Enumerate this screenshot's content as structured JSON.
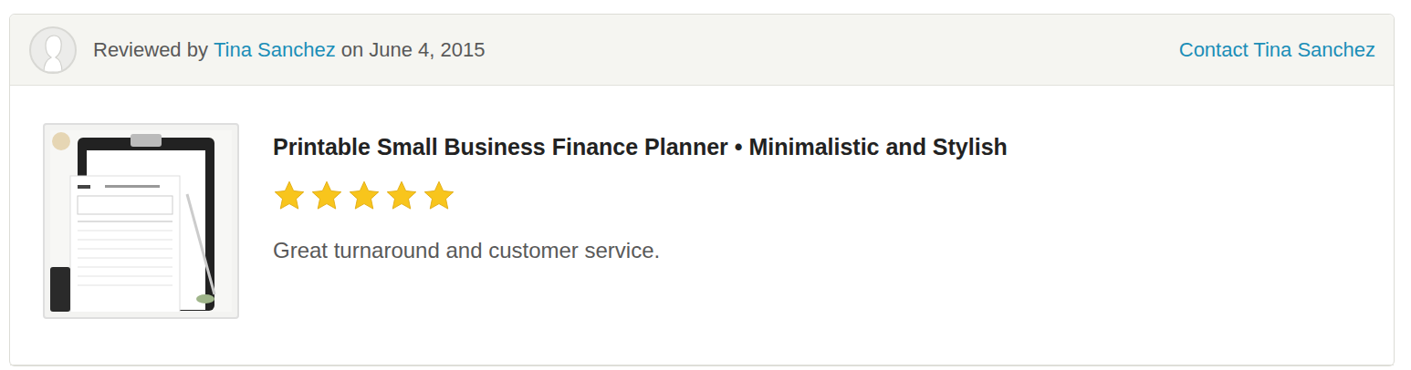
{
  "header": {
    "prefix": "Reviewed by",
    "reviewer": "Tina Sanchez",
    "date": "on June 4, 2015",
    "contact": "Contact Tina Sanchez"
  },
  "review": {
    "title": "Printable Small Business Finance Planner • Minimalistic and Stylish",
    "stars": 5,
    "text": "Great turnaround and customer service."
  }
}
